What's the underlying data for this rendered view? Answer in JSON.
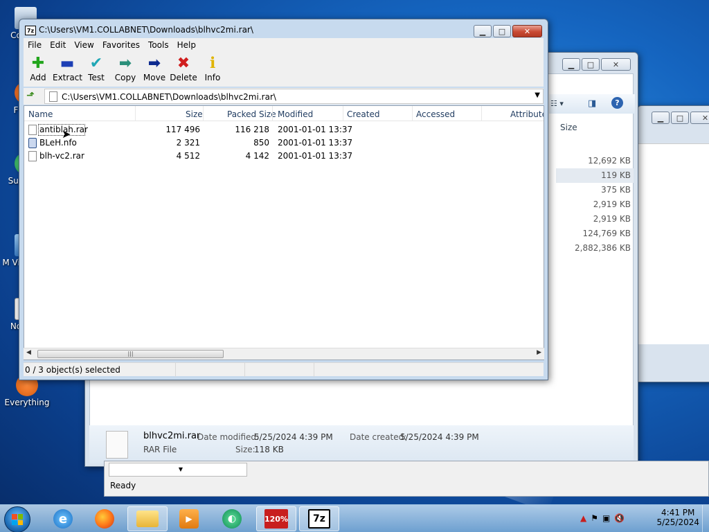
{
  "desktop": {
    "icons": [
      {
        "label": "Co"
      },
      {
        "label": "F"
      },
      {
        "label": "Sup"
      },
      {
        "label": "M Visu"
      },
      {
        "label": "No"
      },
      {
        "label": "Everything"
      }
    ]
  },
  "explorer": {
    "sizes_header": "Size",
    "sizes": [
      "12,692 KB",
      "119 KB",
      "375 KB",
      "2,919 KB",
      "2,919 KB",
      "124,769 KB",
      "2,882,386 KB"
    ],
    "details": {
      "filename": "blhvc2mi.rar",
      "filetype": "RAR File",
      "date_modified_label": "Date modified:",
      "date_modified": "5/25/2024 4:39 PM",
      "date_created_label": "Date created:",
      "date_created": "5/25/2024 4:39 PM",
      "size_label": "Size:",
      "size": "118 KB"
    }
  },
  "lower_window": {
    "status": "Ready"
  },
  "zip": {
    "title": "C:\\Users\\VM1.COLLABNET\\Downloads\\blhvc2mi.rar\\",
    "app_icon": "7z",
    "menu": [
      "File",
      "Edit",
      "View",
      "Favorites",
      "Tools",
      "Help"
    ],
    "toolbar": [
      {
        "label": "Add",
        "icon": "plus-icon",
        "color": "#22a51c",
        "glyph": "✚"
      },
      {
        "label": "Extract",
        "icon": "minus-icon",
        "color": "#1d3fb5",
        "glyph": "▬"
      },
      {
        "label": "Test",
        "icon": "check-icon",
        "color": "#20a7b5",
        "glyph": "✔"
      },
      {
        "label": "Copy",
        "icon": "arrow-right-icon",
        "color": "#2a8f7a",
        "glyph": "➡"
      },
      {
        "label": "Move",
        "icon": "arrow-right-bold-icon",
        "color": "#0d2a8f",
        "glyph": "➡"
      },
      {
        "label": "Delete",
        "icon": "delete-x-icon",
        "color": "#d01e1e",
        "glyph": "✖"
      },
      {
        "label": "Info",
        "icon": "info-icon",
        "color": "#e0b400",
        "glyph": "ℹ"
      }
    ],
    "address": "C:\\Users\\VM1.COLLABNET\\Downloads\\blhvc2mi.rar\\",
    "columns": [
      "Name",
      "Size",
      "Packed Size",
      "Modified",
      "Created",
      "Accessed",
      "Attribute"
    ],
    "files": [
      {
        "name": "antiblah.rar",
        "size": "117 496",
        "packed": "116 218",
        "modified": "2001-01-01 13:37"
      },
      {
        "name": "BLeH.nfo",
        "size": "2 321",
        "packed": "850",
        "modified": "2001-01-01 13:37"
      },
      {
        "name": "blh-vc2.rar",
        "size": "4 512",
        "packed": "4 142",
        "modified": "2001-01-01 13:37"
      }
    ],
    "status": "0 / 3 object(s) selected"
  },
  "taskbar": {
    "apps": [
      {
        "name": "Internet Explorer",
        "icon": "ie-icon"
      },
      {
        "name": "Firefox",
        "icon": "firefox-icon"
      },
      {
        "name": "Windows Explorer",
        "icon": "folder-icon"
      },
      {
        "name": "Media Player",
        "icon": "media-player-icon"
      },
      {
        "name": "Chat",
        "icon": "chat-icon"
      },
      {
        "name": "Acrobat",
        "icon": "acrobat-icon",
        "badge": "120%"
      },
      {
        "name": "7-Zip",
        "icon": "7zip-icon",
        "badge": "7z"
      }
    ],
    "time": "4:41 PM",
    "date": "5/25/2024"
  }
}
